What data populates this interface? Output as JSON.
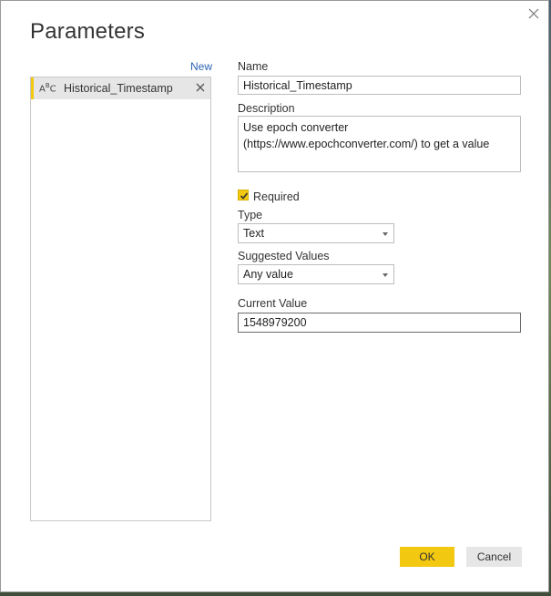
{
  "dialog": {
    "title": "Parameters",
    "new_link": "New",
    "close_icon": "close-icon"
  },
  "parameters_list": [
    {
      "type_icon": "text-type-icon",
      "name": "Historical_Timestamp",
      "selected": true
    }
  ],
  "form": {
    "name_label": "Name",
    "name_value": "Historical_Timestamp",
    "description_label": "Description",
    "description_value": "Use epoch converter (https://www.epochconverter.com/) to get a value",
    "required_label": "Required",
    "required_checked": true,
    "type_label": "Type",
    "type_value": "Text",
    "suggested_values_label": "Suggested Values",
    "suggested_values_value": "Any value",
    "current_value_label": "Current Value",
    "current_value": "1548979200"
  },
  "buttons": {
    "ok": "OK",
    "cancel": "Cancel"
  },
  "colors": {
    "accent": "#f2c811",
    "link": "#2b63b2"
  }
}
